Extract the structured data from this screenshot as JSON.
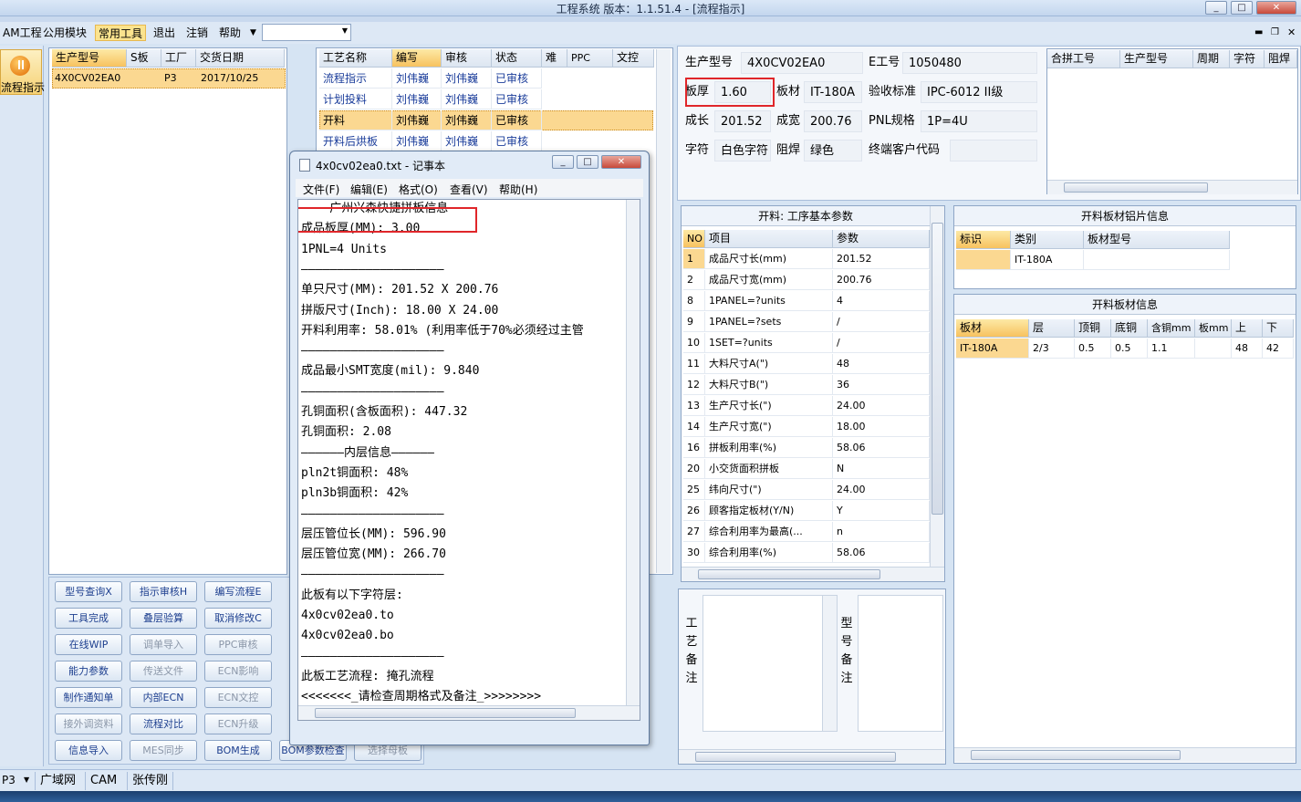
{
  "window": {
    "title": "工程系统   版本：1.1.51.4 - [流程指示]"
  },
  "menu": {
    "items": [
      "AM工程",
      "公用模块",
      "常用工具",
      "退出",
      "注销",
      "帮助"
    ],
    "active": "常用工具"
  },
  "left_nav": {
    "label": "流程指示"
  },
  "orders": {
    "headers": [
      "生产型号",
      "S板",
      "工厂",
      "交货日期"
    ],
    "row": {
      "model": "4X0CV02EA0",
      "s": "",
      "factory": "P3",
      "date": "2017/10/25"
    }
  },
  "process": {
    "headers": [
      "工艺名称",
      "编写",
      "审核",
      "状态",
      "难",
      "PPC",
      "文控"
    ],
    "rows": [
      {
        "name": "流程指示",
        "writer": "刘伟巍",
        "reviewer": "刘伟巍",
        "status": "已审核"
      },
      {
        "name": "计划投料",
        "writer": "刘伟巍",
        "reviewer": "刘伟巍",
        "status": "已审核"
      },
      {
        "name": "开料",
        "writer": "刘伟巍",
        "reviewer": "刘伟巍",
        "status": "已审核"
      },
      {
        "name": "开料后烘板",
        "writer": "刘伟巍",
        "reviewer": "刘伟巍",
        "status": "已审核"
      }
    ]
  },
  "buttons": [
    [
      "型号查询X",
      "指示审核H",
      "编写流程E"
    ],
    [
      "工具完成",
      "叠层验算",
      "取消修改C"
    ],
    [
      "在线WIP",
      "调单导入",
      "PPC审核"
    ],
    [
      "能力参数",
      "传送文件",
      "ECN影响"
    ],
    [
      "制作通知单",
      "内部ECN",
      "ECN文控"
    ],
    [
      "接外调资料",
      "流程对比",
      "ECN升级"
    ],
    [
      "信息导入",
      "MES同步",
      "BOM生成"
    ]
  ],
  "buttons_extra": {
    "bom_check": "BOM参数检查",
    "select_board": "选择母板"
  },
  "notepad": {
    "title": "4x0cv02ea0.txt - 记事本",
    "menu": [
      "文件(F)",
      "编辑(E)",
      "格式(O)",
      "查看(V)",
      "帮助(H)"
    ],
    "lines": [
      "————广州兴森快捷拼板信息——",
      "成品板厚(MM): 3.00",
      "1PNL=4 Units",
      "————————————————————",
      "单只尺寸(MM): 201.52 X 200.76",
      "拼版尺寸(Inch): 18.00 X 24.00",
      "开料利用率: 58.01% (利用率低于70%必须经过主管",
      "————————————————————",
      "成品最小SMT宽度(mil): 9.840",
      "————————————————————",
      "孔铜面积(含板面积): 447.32",
      "孔铜面积: 2.08",
      "——————内层信息——————",
      "pln2t铜面积: 48%",
      "pln3b铜面积: 42%",
      "————————————————————",
      "层压管位长(MM): 596.90",
      "层压管位宽(MM): 266.70",
      "————————————————————",
      "此板有以下字符层:",
      "4x0cv02ea0.to",
      "4x0cv02ea0.bo",
      "————————————————————",
      "此板工艺流程: 掩孔流程",
      "<<<<<<<_请检查周期格式及备注_>>>>>>>>"
    ]
  },
  "info": {
    "model_label": "生产型号",
    "model": "4X0CV02EA0",
    "eno_label": "E工号",
    "eno": "1050480",
    "thickness_label": "板厚",
    "thickness": "1.60",
    "material_label": "板材",
    "material": "IT-180A",
    "standard_label": "验收标准",
    "standard": "IPC-6012 II级",
    "length_label": "成长",
    "length": "201.52",
    "width_label": "成宽",
    "width": "200.76",
    "pnl_label": "PNL规格",
    "pnl": "1P=4U",
    "char_label": "字符",
    "char": "白色字符",
    "mask_label": "阻焊",
    "mask": "绿色",
    "customer_label": "终端客户代码",
    "customer": ""
  },
  "combine": {
    "headers": [
      "合拼工号",
      "生产型号",
      "周期",
      "字符",
      "阻焊"
    ]
  },
  "params": {
    "title": "开料: 工序基本参数",
    "headers": [
      "NO",
      "项目",
      "参数"
    ],
    "rows": [
      {
        "no": "1",
        "item": "成品尺寸长(mm)",
        "value": "201.52"
      },
      {
        "no": "2",
        "item": "成品尺寸宽(mm)",
        "value": "200.76"
      },
      {
        "no": "8",
        "item": "1PANEL=?units",
        "value": "4"
      },
      {
        "no": "9",
        "item": "1PANEL=?sets",
        "value": "/"
      },
      {
        "no": "10",
        "item": "1SET=?units",
        "value": "/"
      },
      {
        "no": "11",
        "item": "大料尺寸A(\")",
        "value": "48"
      },
      {
        "no": "12",
        "item": "大料尺寸B(\")",
        "value": "36"
      },
      {
        "no": "13",
        "item": "生产尺寸长(\")",
        "value": "24.00"
      },
      {
        "no": "14",
        "item": "生产尺寸宽(\")",
        "value": "18.00"
      },
      {
        "no": "16",
        "item": "拼板利用率(%)",
        "value": "58.06"
      },
      {
        "no": "20",
        "item": "小交货面积拼板",
        "value": "N"
      },
      {
        "no": "25",
        "item": "纬向尺寸(\")",
        "value": "24.00"
      },
      {
        "no": "26",
        "item": "顾客指定板材(Y/N)",
        "value": "Y"
      },
      {
        "no": "27",
        "item": "综合利用率为最高(...",
        "value": "n"
      },
      {
        "no": "30",
        "item": "综合利用率(%)",
        "value": "58.06"
      }
    ]
  },
  "sheet_info": {
    "title": "开料板材铝片信息",
    "headers": [
      "标识",
      "类别",
      "板材型号"
    ],
    "row": {
      "id": "",
      "category": "IT-180A",
      "model": ""
    }
  },
  "board_info": {
    "title": "开料板材信息",
    "headers": [
      "板材",
      "层",
      "顶铜",
      "底铜",
      "含铜mm",
      "板mm",
      "上",
      "下"
    ],
    "row": {
      "material": "IT-180A",
      "layer": "2/3",
      "top": "0.5",
      "bottom": "0.5",
      "cu": "1.1",
      "board": "",
      "up": "48",
      "down": "42"
    }
  },
  "remarks": {
    "process_label": "工艺备注",
    "model_label": "型号备注"
  },
  "statusbar": {
    "items": [
      "P3",
      "广域网",
      "CAM",
      "张传刚"
    ]
  },
  "colors": {
    "highlight": "#fbd891",
    "header_selected": "#f7c25f",
    "red_box": "#e0262a",
    "link_blue": "#1a3c9a"
  }
}
